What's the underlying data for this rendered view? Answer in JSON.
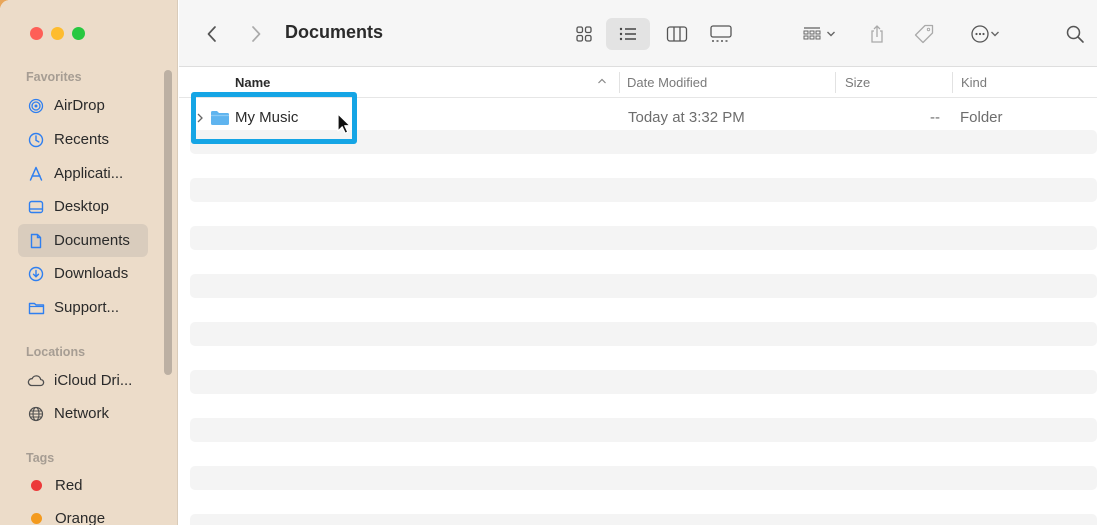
{
  "window": {
    "title": "Documents"
  },
  "sidebar": {
    "sections": {
      "favorites": "Favorites",
      "locations": "Locations",
      "tags": "Tags"
    },
    "favorites": [
      {
        "label": "AirDrop",
        "icon": "airdrop-icon"
      },
      {
        "label": "Recents",
        "icon": "clock-icon"
      },
      {
        "label": "Applicati...",
        "icon": "applications-icon"
      },
      {
        "label": "Desktop",
        "icon": "desktop-icon"
      },
      {
        "label": "Documents",
        "icon": "document-icon",
        "active": true
      },
      {
        "label": "Downloads",
        "icon": "download-icon"
      },
      {
        "label": "Support...",
        "icon": "folder-icon"
      }
    ],
    "locations": [
      {
        "label": "iCloud Dri...",
        "icon": "cloud-icon"
      },
      {
        "label": "Network",
        "icon": "globe-icon"
      }
    ],
    "tags": [
      {
        "label": "Red",
        "color": "#ec3a3a"
      },
      {
        "label": "Orange",
        "color": "#f39a1e"
      }
    ]
  },
  "columns": {
    "name": "Name",
    "date": "Date Modified",
    "size": "Size",
    "kind": "Kind"
  },
  "files": [
    {
      "name": "My Music",
      "date": "Today at 3:32 PM",
      "size": "--",
      "kind": "Folder"
    }
  ],
  "colors": {
    "accent": "#2f7ff0",
    "highlight": "#15a5e5",
    "sidebar_bg": "#ecdcc9",
    "folder": "#5fb4ef"
  }
}
